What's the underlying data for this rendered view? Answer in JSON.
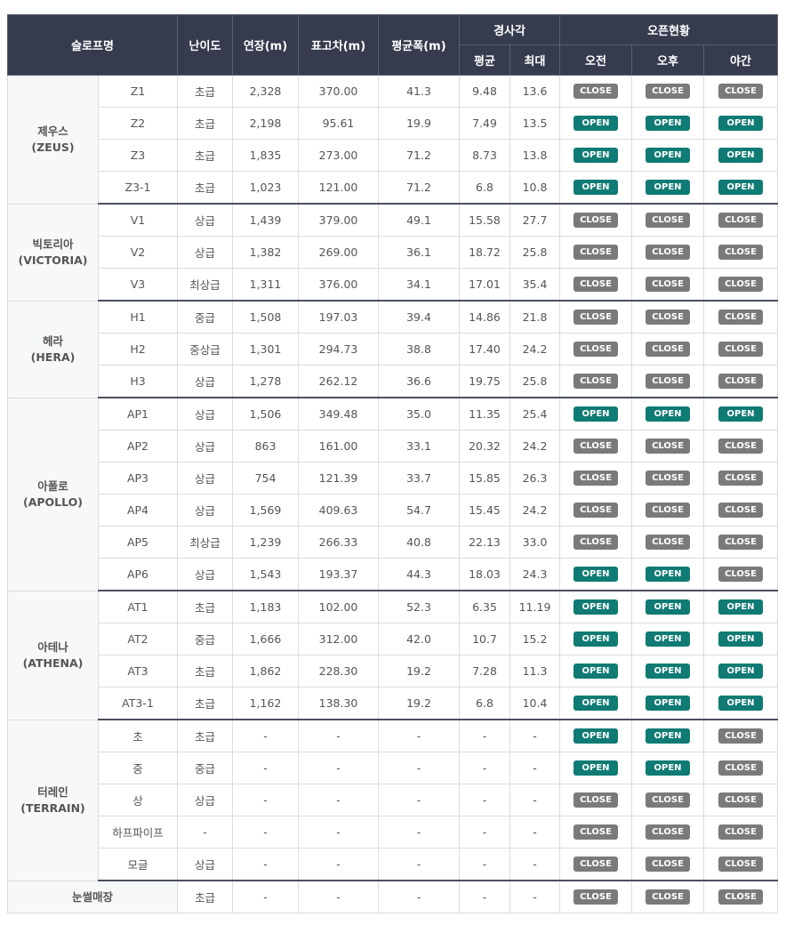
{
  "header": {
    "slope": "슬로프명",
    "difficulty": "난이도",
    "length": "연장(m)",
    "elevation": "표고차(m)",
    "width": "평균폭(m)",
    "gradient": "경사각",
    "gradient_avg": "평균",
    "gradient_max": "최대",
    "open_status": "오픈현황",
    "morning": "오전",
    "afternoon": "오후",
    "night": "야간"
  },
  "groups": [
    {
      "name": "제우스",
      "sub": "(ZEUS)",
      "rows": [
        {
          "course": "Z1",
          "difficulty": "초급",
          "length": "2,328",
          "elevation": "370.00",
          "width": "41.3",
          "avg": "9.48",
          "max": "13.6",
          "am": "CLOSE",
          "pm": "CLOSE",
          "night": "CLOSE"
        },
        {
          "course": "Z2",
          "difficulty": "초급",
          "length": "2,198",
          "elevation": "95.61",
          "width": "19.9",
          "avg": "7.49",
          "max": "13.5",
          "am": "OPEN",
          "pm": "OPEN",
          "night": "OPEN"
        },
        {
          "course": "Z3",
          "difficulty": "초급",
          "length": "1,835",
          "elevation": "273.00",
          "width": "71.2",
          "avg": "8.73",
          "max": "13.8",
          "am": "OPEN",
          "pm": "OPEN",
          "night": "OPEN"
        },
        {
          "course": "Z3-1",
          "difficulty": "초급",
          "length": "1,023",
          "elevation": "121.00",
          "width": "71.2",
          "avg": "6.8",
          "max": "10.8",
          "am": "OPEN",
          "pm": "OPEN",
          "night": "OPEN"
        }
      ]
    },
    {
      "name": "빅토리아",
      "sub": "(VICTORIA)",
      "rows": [
        {
          "course": "V1",
          "difficulty": "상급",
          "length": "1,439",
          "elevation": "379.00",
          "width": "49.1",
          "avg": "15.58",
          "max": "27.7",
          "am": "CLOSE",
          "pm": "CLOSE",
          "night": "CLOSE"
        },
        {
          "course": "V2",
          "difficulty": "상급",
          "length": "1,382",
          "elevation": "269.00",
          "width": "36.1",
          "avg": "18.72",
          "max": "25.8",
          "am": "CLOSE",
          "pm": "CLOSE",
          "night": "CLOSE"
        },
        {
          "course": "V3",
          "difficulty": "최상급",
          "length": "1,311",
          "elevation": "376.00",
          "width": "34.1",
          "avg": "17.01",
          "max": "35.4",
          "am": "CLOSE",
          "pm": "CLOSE",
          "night": "CLOSE"
        }
      ]
    },
    {
      "name": "헤라",
      "sub": "(HERA)",
      "rows": [
        {
          "course": "H1",
          "difficulty": "중급",
          "length": "1,508",
          "elevation": "197.03",
          "width": "39.4",
          "avg": "14.86",
          "max": "21.8",
          "am": "CLOSE",
          "pm": "CLOSE",
          "night": "CLOSE"
        },
        {
          "course": "H2",
          "difficulty": "중상급",
          "length": "1,301",
          "elevation": "294.73",
          "width": "38.8",
          "avg": "17.40",
          "max": "24.2",
          "am": "CLOSE",
          "pm": "CLOSE",
          "night": "CLOSE"
        },
        {
          "course": "H3",
          "difficulty": "상급",
          "length": "1,278",
          "elevation": "262.12",
          "width": "36.6",
          "avg": "19.75",
          "max": "25.8",
          "am": "CLOSE",
          "pm": "CLOSE",
          "night": "CLOSE"
        }
      ]
    },
    {
      "name": "아폴로",
      "sub": "(APOLLO)",
      "rows": [
        {
          "course": "AP1",
          "difficulty": "상급",
          "length": "1,506",
          "elevation": "349.48",
          "width": "35.0",
          "avg": "11.35",
          "max": "25.4",
          "am": "OPEN",
          "pm": "OPEN",
          "night": "OPEN"
        },
        {
          "course": "AP2",
          "difficulty": "상급",
          "length": "863",
          "elevation": "161.00",
          "width": "33.1",
          "avg": "20.32",
          "max": "24.2",
          "am": "CLOSE",
          "pm": "CLOSE",
          "night": "CLOSE"
        },
        {
          "course": "AP3",
          "difficulty": "상급",
          "length": "754",
          "elevation": "121.39",
          "width": "33.7",
          "avg": "15.85",
          "max": "26.3",
          "am": "CLOSE",
          "pm": "CLOSE",
          "night": "CLOSE"
        },
        {
          "course": "AP4",
          "difficulty": "상급",
          "length": "1,569",
          "elevation": "409.63",
          "width": "54.7",
          "avg": "15.45",
          "max": "24.2",
          "am": "CLOSE",
          "pm": "CLOSE",
          "night": "CLOSE"
        },
        {
          "course": "AP5",
          "difficulty": "최상급",
          "length": "1,239",
          "elevation": "266.33",
          "width": "40.8",
          "avg": "22.13",
          "max": "33.0",
          "am": "CLOSE",
          "pm": "CLOSE",
          "night": "CLOSE"
        },
        {
          "course": "AP6",
          "difficulty": "상급",
          "length": "1,543",
          "elevation": "193.37",
          "width": "44.3",
          "avg": "18.03",
          "max": "24.3",
          "am": "OPEN",
          "pm": "OPEN",
          "night": "CLOSE"
        }
      ]
    },
    {
      "name": "아테나",
      "sub": "(ATHENA)",
      "rows": [
        {
          "course": "AT1",
          "difficulty": "초급",
          "length": "1,183",
          "elevation": "102.00",
          "width": "52.3",
          "avg": "6.35",
          "max": "11.19",
          "am": "OPEN",
          "pm": "OPEN",
          "night": "OPEN"
        },
        {
          "course": "AT2",
          "difficulty": "중급",
          "length": "1,666",
          "elevation": "312.00",
          "width": "42.0",
          "avg": "10.7",
          "max": "15.2",
          "am": "OPEN",
          "pm": "OPEN",
          "night": "OPEN"
        },
        {
          "course": "AT3",
          "difficulty": "초급",
          "length": "1,862",
          "elevation": "228.30",
          "width": "19.2",
          "avg": "7.28",
          "max": "11.3",
          "am": "OPEN",
          "pm": "OPEN",
          "night": "OPEN"
        },
        {
          "course": "AT3-1",
          "difficulty": "초급",
          "length": "1,162",
          "elevation": "138.30",
          "width": "19.2",
          "avg": "6.8",
          "max": "10.4",
          "am": "OPEN",
          "pm": "OPEN",
          "night": "OPEN"
        }
      ]
    },
    {
      "name": "터레인",
      "sub": "(TERRAIN)",
      "rows": [
        {
          "course": "초",
          "difficulty": "초급",
          "length": "-",
          "elevation": "-",
          "width": "-",
          "avg": "-",
          "max": "-",
          "am": "OPEN",
          "pm": "OPEN",
          "night": "CLOSE"
        },
        {
          "course": "중",
          "difficulty": "중급",
          "length": "-",
          "elevation": "-",
          "width": "-",
          "avg": "-",
          "max": "-",
          "am": "OPEN",
          "pm": "OPEN",
          "night": "CLOSE"
        },
        {
          "course": "상",
          "difficulty": "상급",
          "length": "-",
          "elevation": "-",
          "width": "-",
          "avg": "-",
          "max": "-",
          "am": "CLOSE",
          "pm": "CLOSE",
          "night": "CLOSE"
        },
        {
          "course": "하프파이프",
          "difficulty": "-",
          "length": "-",
          "elevation": "-",
          "width": "-",
          "avg": "-",
          "max": "-",
          "am": "CLOSE",
          "pm": "CLOSE",
          "night": "CLOSE"
        },
        {
          "course": "모글",
          "difficulty": "상급",
          "length": "-",
          "elevation": "-",
          "width": "-",
          "avg": "-",
          "max": "-",
          "am": "CLOSE",
          "pm": "CLOSE",
          "night": "CLOSE"
        }
      ]
    }
  ],
  "single": {
    "name": "눈썰매장",
    "difficulty": "초급",
    "length": "-",
    "elevation": "-",
    "width": "-",
    "avg": "-",
    "max": "-",
    "am": "CLOSE",
    "pm": "CLOSE",
    "night": "CLOSE"
  },
  "colors": {
    "open": "#0f7b74",
    "close": "#7a7a7a",
    "header": "#363c4e"
  }
}
